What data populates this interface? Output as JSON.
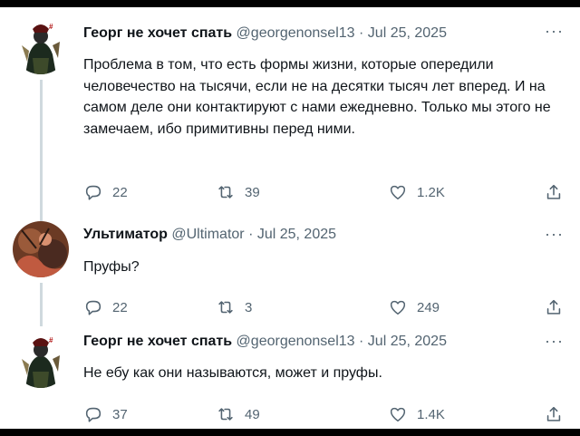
{
  "tweets": [
    {
      "author": "Георг не хочет спать",
      "handle": "@georgenonsel13",
      "date": "Jul 25, 2025",
      "text": "Проблема в том, что есть формы жизни, которые опередили человечество на тысячи, если не на десятки тысяч лет вперед. И на самом деле они контактируют с нами ежедневно. Только мы этого не замечаем, ибо примитивны перед ними.",
      "replies": "22",
      "retweets": "39",
      "likes": "1.2K"
    },
    {
      "author": "Ультиматор",
      "handle": "@Ultimator",
      "date": "Jul 25, 2025",
      "text": "Пруфы?",
      "replies": "22",
      "retweets": "3",
      "likes": "249"
    },
    {
      "author": "Георг не хочет спать",
      "handle": "@georgenonsel13",
      "date": "Jul 25, 2025",
      "text": "Не ебу как они называются, может и пруфы.",
      "replies": "37",
      "retweets": "49",
      "likes": "1.4K"
    }
  ],
  "separator": "·",
  "more_icon": "···",
  "icons": {
    "reply": "reply-icon",
    "retweet": "retweet-icon",
    "like": "heart-icon",
    "share": "share-icon"
  },
  "colors": {
    "text": "#0f1419",
    "secondary": "#536471",
    "thread_line": "#cfd9de"
  }
}
